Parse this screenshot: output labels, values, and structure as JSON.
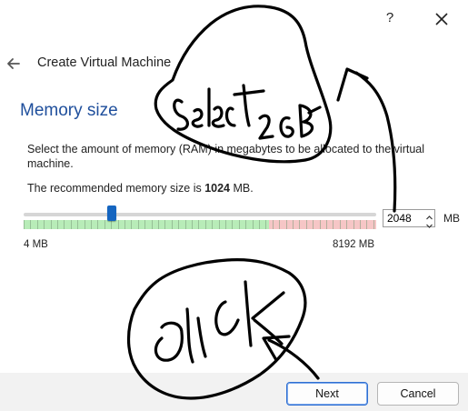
{
  "window": {
    "help_label": "?",
    "close_icon": "close-icon",
    "back_icon": "back-arrow-icon"
  },
  "wizard": {
    "title": "Create Virtual Machine",
    "page_title": "Memory size",
    "description": "Select the amount of memory (RAM) in megabytes to be allocated to the virtual machine.",
    "recommend_prefix": "The recommended memory size is ",
    "recommend_value": "1024",
    "recommend_suffix": " MB."
  },
  "memory": {
    "slider_min_label": "4 MB",
    "slider_max_label": "8192 MB",
    "min_mb": 4,
    "max_mb": 8192,
    "value_mb": 2048,
    "safe_limit_mb": 5700,
    "spin_value": "2048",
    "unit": "MB",
    "colors": {
      "safe": "#b8ecb8",
      "warn": "#f6c6c6",
      "handle": "#1565c0"
    }
  },
  "buttons": {
    "next": "Next",
    "cancel": "Cancel"
  },
  "annotations": {
    "handwritten_1": "select",
    "handwritten_2": "2GB",
    "handwritten_3": "click"
  },
  "theme": {
    "accent": "#1f4f9c",
    "primary_border": "#2f6fd1"
  }
}
